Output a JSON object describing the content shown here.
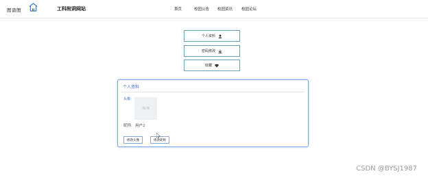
{
  "header": {
    "logo_text": "图谱图",
    "site_title": "工科附洞网站",
    "nav": [
      "首页",
      "校园公告",
      "校园资讯",
      "校园论坛"
    ]
  },
  "menu": {
    "items": [
      {
        "label": "个人资料",
        "icon": "user-icon"
      },
      {
        "label": "密码修改",
        "icon": "download-icon"
      },
      {
        "label": "收藏",
        "icon": "heart-icon"
      }
    ]
  },
  "profile": {
    "title": "个人资料",
    "avatar_label": "头像:",
    "avatar_placeholder": "N/A",
    "nickname_label": "昵称:",
    "nickname_value": "用户2",
    "change_avatar_label": "修改头像",
    "change_nickname_label": "修改昵称"
  },
  "watermark": "CSDN @BYSJ1987",
  "colors": {
    "accent": "#3a6fc0",
    "menu_border": "#6aa0b8",
    "card_border": "#7aa7e6"
  }
}
